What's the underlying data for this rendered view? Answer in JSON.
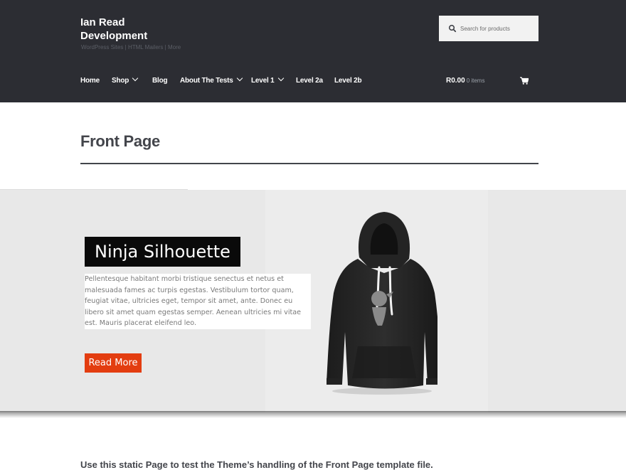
{
  "site": {
    "title": "Ian Read Development",
    "tagline": "WordPress Sites | HTML Mailers | More"
  },
  "search": {
    "placeholder": "Search for products"
  },
  "nav": {
    "items": [
      {
        "label": "Home"
      },
      {
        "label": "Shop",
        "has_dropdown": true
      },
      {
        "label": "Blog"
      },
      {
        "label": "About The Tests",
        "has_dropdown": true
      },
      {
        "label": "Level 1",
        "has_dropdown": true
      },
      {
        "label": "Level 2a"
      },
      {
        "label": "Level 2b"
      }
    ]
  },
  "cart": {
    "amount": "R0.00",
    "count": "0 items",
    "icon": "cart-icon"
  },
  "page": {
    "title": "Front Page"
  },
  "hero": {
    "heading": "Ninja Silhouette",
    "text": "Pellentesque habitant morbi tristique senectus et netus et malesuada fames ac turpis egestas. Vestibulum tortor quam, feugiat vitae, ultricies eget, tempor sit amet, ante. Donec eu libero sit amet quam egestas semper. Aenean ultricies mi vitae est. Mauris placerat eleifend leo.",
    "button_label": "Read More",
    "button_color": "#e33d10"
  },
  "intro": {
    "text": "Use this static Page to test the Theme’s handling of the Front Page template file."
  },
  "colors": {
    "header_bg": "#2c2d33",
    "text_dark": "#43454b",
    "hero_bg": "#e8e8e8"
  }
}
